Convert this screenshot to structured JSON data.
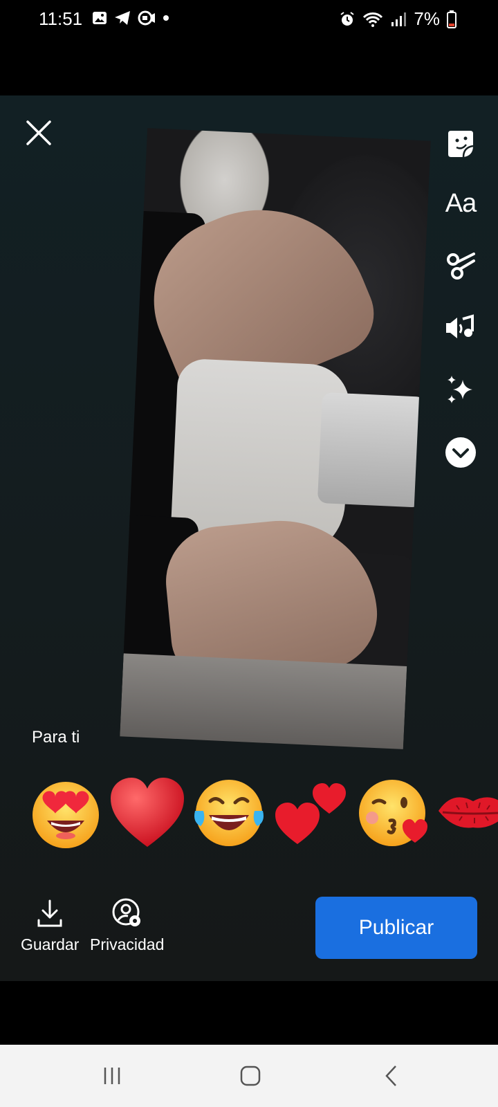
{
  "status_bar": {
    "time": "11:51",
    "battery": "7%",
    "left_icons": [
      "gallery-icon",
      "telegram-icon",
      "video-icon",
      "dot-icon"
    ],
    "right_icons": [
      "alarm-icon",
      "wifi-icon",
      "signal-icon",
      "battery-icon"
    ]
  },
  "editor": {
    "close_icon": "close-icon",
    "audience_label": "Para ti",
    "tools": [
      {
        "name": "sticker-icon"
      },
      {
        "name": "text-tool",
        "label": "Aa"
      },
      {
        "name": "scissors-icon"
      },
      {
        "name": "music-icon"
      },
      {
        "name": "sparkles-icon"
      },
      {
        "name": "chevron-down-icon"
      }
    ],
    "reactions": [
      "smiling-face-with-heart-eyes",
      "red-heart",
      "face-with-tears-of-joy",
      "two-hearts",
      "face-blowing-kiss",
      "kiss-mark"
    ]
  },
  "actions": {
    "save_label": "Guardar",
    "privacy_label": "Privacidad",
    "publish_label": "Publicar"
  },
  "colors": {
    "publish_button": "#1a6fe0",
    "editor_background": "#141c1e",
    "nav_background": "#f3f3f3"
  },
  "nav_bar": {
    "buttons": [
      "recent-apps-icon",
      "home-icon",
      "back-icon"
    ]
  }
}
